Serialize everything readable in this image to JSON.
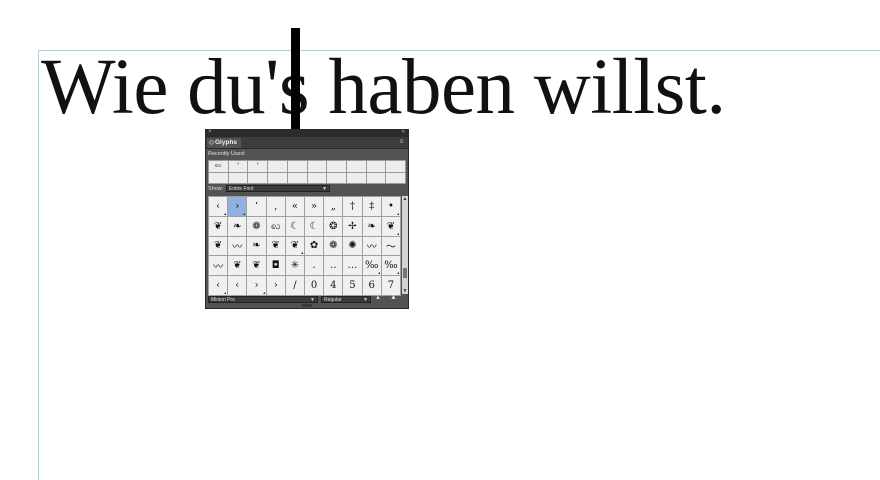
{
  "document": {
    "headline": "Wie du's haben willst."
  },
  "panel": {
    "close_glyph": "×",
    "collapse_glyph": "«",
    "tab_icon": "◇",
    "title": "Glyphs",
    "menu_icon": "≡",
    "recently_used_label": "Recently Used:",
    "recent_glyphs": [
      "ꩮ",
      "'",
      "’",
      "",
      "",
      "",
      "",
      "",
      "",
      "",
      "",
      "",
      "",
      "",
      "",
      "",
      "",
      "",
      "",
      ""
    ],
    "show_label": "Show:",
    "show_value": "Entire Font",
    "dropdown_arrow": "▼",
    "glyphs": [
      "‹",
      "›",
      "‘",
      "‚",
      "«",
      "»",
      "„",
      "†",
      "‡",
      "•",
      "❦",
      "❧",
      "❁",
      "ꩮ",
      "☾",
      "☾",
      "❂",
      "✢",
      "❧",
      "❦",
      "❦",
      "〰",
      "❧",
      "❦",
      "❦",
      "✿",
      "❁",
      "✺",
      "〰",
      "〜",
      "〰",
      "❦",
      "❦",
      "◘",
      "✳",
      ".",
      "‥",
      "…",
      "‰",
      "‰",
      "‹",
      "‹",
      "›",
      "›",
      "/",
      "0",
      "4",
      "5",
      "6",
      "7"
    ],
    "glyphs_with_alternates": [
      0,
      1,
      9,
      19,
      24,
      38,
      39,
      40,
      42
    ],
    "selected_glyph_index": 1,
    "scroll_up": "▲",
    "scroll_down": "▼",
    "font_family": "Minion Pro",
    "font_style": "Regular",
    "zoom_out": "▲",
    "zoom_in": "▲"
  }
}
